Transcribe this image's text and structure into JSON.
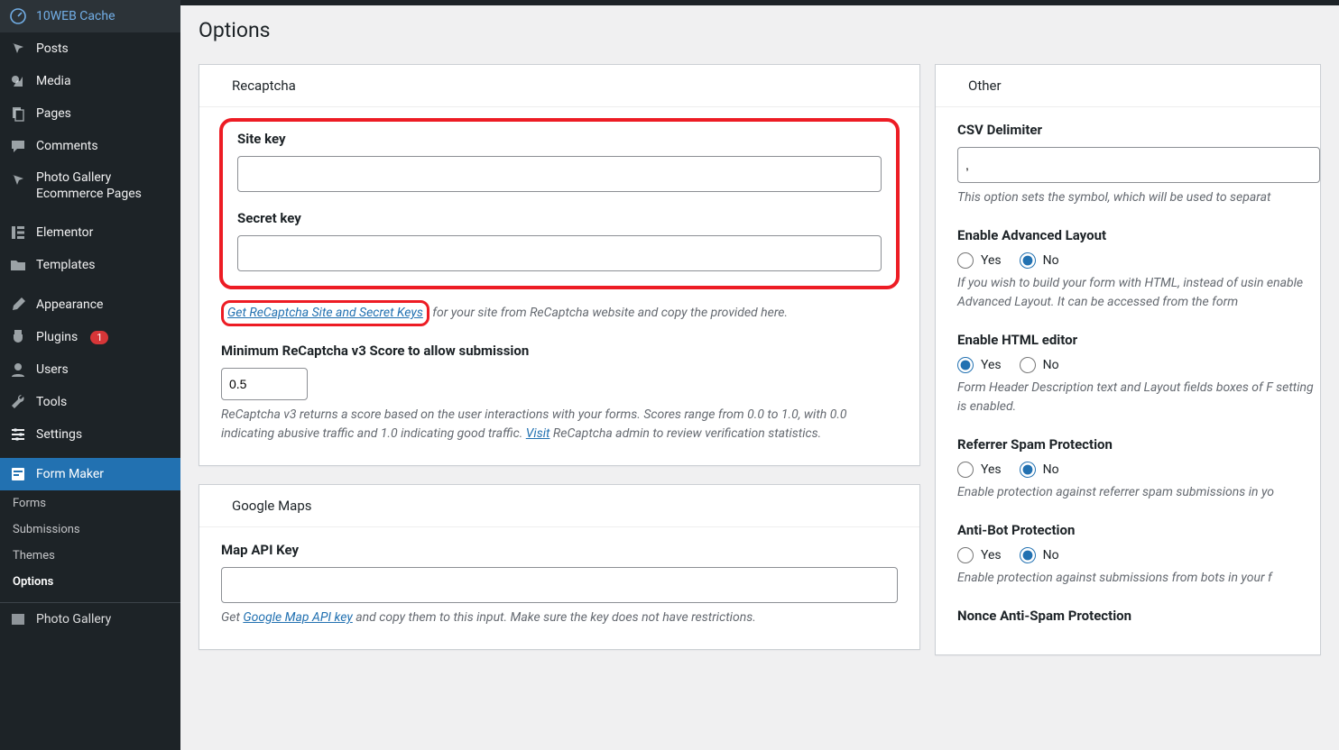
{
  "sidebar": {
    "items": [
      {
        "label": "10WEB Cache",
        "icon": "gauge"
      },
      {
        "label": "Posts",
        "icon": "pin"
      },
      {
        "label": "Media",
        "icon": "media"
      },
      {
        "label": "Pages",
        "icon": "pages"
      },
      {
        "label": "Comments",
        "icon": "comment"
      },
      {
        "label": "Photo Gallery Ecommerce Pages",
        "icon": "pin"
      },
      {
        "label": "Elementor",
        "icon": "elementor"
      },
      {
        "label": "Templates",
        "icon": "folder"
      },
      {
        "label": "Appearance",
        "icon": "brush"
      },
      {
        "label": "Plugins",
        "icon": "plug",
        "badge": "1"
      },
      {
        "label": "Users",
        "icon": "user"
      },
      {
        "label": "Tools",
        "icon": "wrench"
      },
      {
        "label": "Settings",
        "icon": "sliders"
      },
      {
        "label": "Form Maker",
        "icon": "form",
        "active": true
      }
    ],
    "sub": [
      {
        "label": "Forms"
      },
      {
        "label": "Submissions"
      },
      {
        "label": "Themes"
      },
      {
        "label": "Options",
        "bold": true
      },
      {
        "label": "Photo Gallery"
      }
    ]
  },
  "page": {
    "title": "Options"
  },
  "recaptcha": {
    "card_title": "Recaptcha",
    "site_key_label": "Site key",
    "secret_key_label": "Secret key",
    "get_keys_link": "Get ReCaptcha Site and Secret Keys",
    "get_keys_rest": " for your site from ReCaptcha website and copy the provided here.",
    "min_score_label": "Minimum ReCaptcha v3 Score to allow submission",
    "min_score_value": "0.5",
    "desc1": "ReCaptcha v3 returns a score based on the user interactions with your forms. Scores range from 0.0 to 1.0, with 0.0 indicating abusive traffic and 1.0 indicating good traffic. ",
    "visit_link": "Visit",
    "desc2": " ReCaptcha admin to review verification statistics."
  },
  "maps": {
    "card_title": "Google Maps",
    "api_key_label": "Map API Key",
    "desc_pre": "Get ",
    "api_link": "Google Map API key",
    "desc_post": " and copy them to this input. Make sure the key does not have restrictions."
  },
  "other": {
    "card_title": "Other",
    "csv_label": "CSV Delimiter",
    "csv_value": ",",
    "csv_desc": "This option sets the symbol, which will be used to separat",
    "adv_layout_label": "Enable Advanced Layout",
    "adv_layout_desc": "If you wish to build your form with HTML, instead of usin enable Advanced Layout. It can be accessed from the form",
    "html_editor_label": "Enable HTML editor",
    "html_editor_desc": "Form Header Description text and Layout fields boxes of F setting is enabled.",
    "spam_label": "Referrer Spam Protection",
    "spam_desc": "Enable protection against referrer spam submissions in yo",
    "antibot_label": "Anti-Bot Protection",
    "antibot_desc": "Enable protection against submissions from bots in your f",
    "nonce_label": "Nonce Anti-Spam Protection",
    "yes": "Yes",
    "no": "No"
  }
}
